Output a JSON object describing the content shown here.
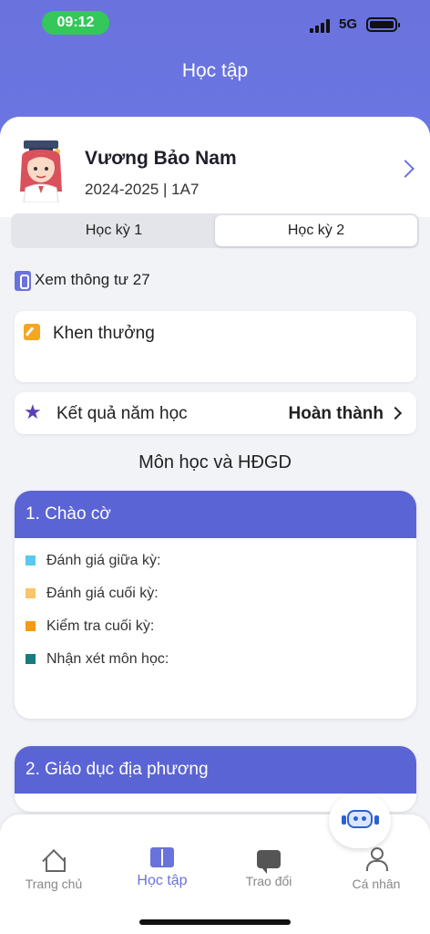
{
  "status_bar": {
    "time": "09:12",
    "network": "5G"
  },
  "header": {
    "title": "Học tập"
  },
  "profile": {
    "name": "Vương Bảo Nam",
    "class_info": "2024-2025 | 1A7"
  },
  "semester_tabs": [
    {
      "label": "Học kỳ 1",
      "selected": false
    },
    {
      "label": "Học kỳ 2",
      "selected": true
    }
  ],
  "circular_link": "Xem thông tư 27",
  "reward": {
    "label": "Khen thưởng"
  },
  "year_result": {
    "label": "Kết quả năm học",
    "value": "Hoàn thành"
  },
  "section_title": "Môn học và HĐGD",
  "subjects": [
    {
      "title": "1. Chào cờ",
      "items": [
        {
          "label": "Đánh giá giữa kỳ:",
          "color": "#5bc8f0"
        },
        {
          "label": "Đánh giá cuối kỳ:",
          "color": "#f9c46b"
        },
        {
          "label": "Kiểm tra cuối kỳ:",
          "color": "#f59a16"
        },
        {
          "label": "Nhận xét môn học:",
          "color": "#177c80"
        }
      ]
    },
    {
      "title": "2. Giáo dục địa phương"
    }
  ],
  "bottom_nav": [
    {
      "label": "Trang chủ",
      "icon": "home-icon"
    },
    {
      "label": "Học tập",
      "icon": "book-icon",
      "active": true
    },
    {
      "label": "Trao đổi",
      "icon": "chat-icon"
    },
    {
      "label": "Cá nhân",
      "icon": "person-icon"
    }
  ],
  "colors": {
    "primary": "#6a72dd",
    "header_card": "#5b64d4"
  }
}
